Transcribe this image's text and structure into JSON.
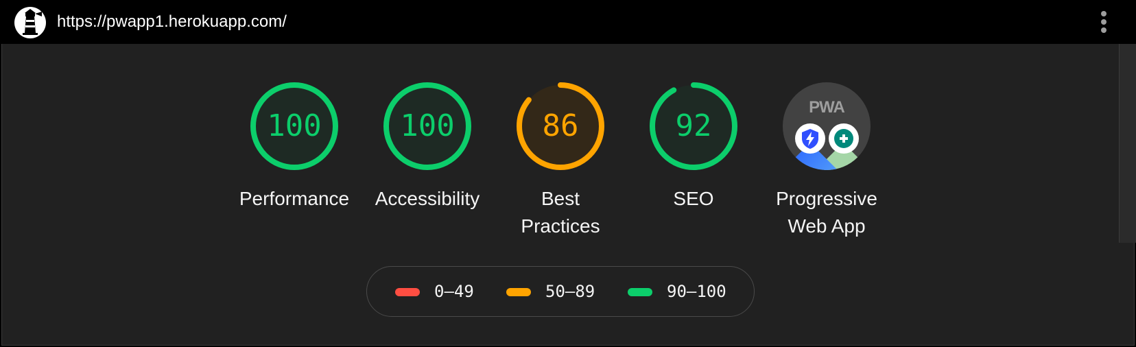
{
  "window": {
    "url": "https://pwapp1.herokuapp.com/",
    "logo_icon": "lighthouse-icon",
    "menu_icon": "more-vertical-icon"
  },
  "gauges": [
    {
      "label": "Performance",
      "score": "100",
      "fraction": 1.0,
      "rating": "pass"
    },
    {
      "label": "Accessibility",
      "score": "100",
      "fraction": 1.0,
      "rating": "pass"
    },
    {
      "label_line1": "Best",
      "label_line2": "Practices",
      "score": "86",
      "fraction": 0.86,
      "rating": "average"
    },
    {
      "label": "SEO",
      "score": "92",
      "fraction": 0.92,
      "rating": "pass"
    }
  ],
  "pwa": {
    "badge_text": "PWA",
    "label_line1": "Progressive",
    "label_line2": "Web App",
    "badge_icons": [
      "lightning-shield-icon",
      "plus-icon"
    ]
  },
  "legend": [
    {
      "range": "0–49",
      "color": "#ff4e42"
    },
    {
      "range": "50–89",
      "color": "#ffa400"
    },
    {
      "range": "90–100",
      "color": "#0cce6b"
    }
  ],
  "colors": {
    "pass": "#0cce6b",
    "average": "#ffa400",
    "fail": "#ff4e42",
    "background": "#212121"
  }
}
